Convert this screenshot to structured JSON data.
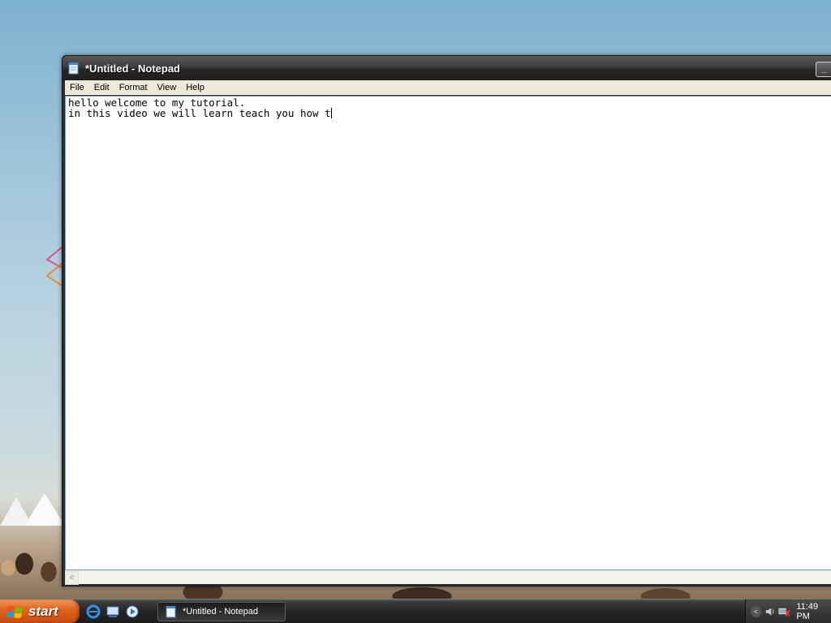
{
  "window": {
    "title": "*Untitled - Notepad",
    "minimize_glyph": "_"
  },
  "menubar": {
    "items": [
      {
        "label": "File"
      },
      {
        "label": "Edit"
      },
      {
        "label": "Format"
      },
      {
        "label": "View"
      },
      {
        "label": "Help"
      }
    ]
  },
  "editor": {
    "line1": "hello welcome to my tutorial.",
    "line2": "in this video we will learn teach you how t"
  },
  "scrollbar": {
    "left_arrow": "<"
  },
  "taskbar": {
    "start_label": "start",
    "task_label": "*Untitled - Notepad",
    "tray_arrow": "<",
    "clock": "11:49 PM"
  },
  "icons": {
    "app": "notepad-icon",
    "start": "windows-flag-icon",
    "quicklaunch": [
      "internet-explorer-icon",
      "show-desktop-icon",
      "media-player-icon"
    ],
    "tray": [
      "network-icon",
      "volume-icon"
    ]
  },
  "colors": {
    "start_button": "#e0651d",
    "titlebar": "#2b2b2b",
    "menubar": "#ece9d8"
  }
}
